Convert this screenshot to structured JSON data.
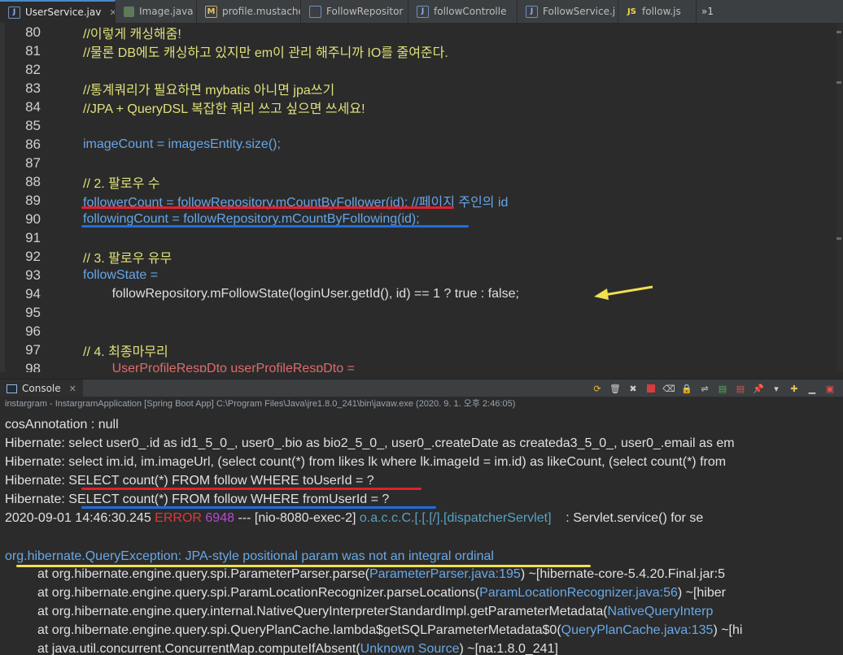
{
  "editor_tabs": [
    {
      "label": "UserService.jav",
      "icon": "java-file-icon",
      "active": true
    },
    {
      "label": "Image.java",
      "icon": "java-file-icon",
      "active": false
    },
    {
      "label": "profile.mustache",
      "icon": "mustache-file-icon",
      "active": false
    },
    {
      "label": "FollowRepositor",
      "icon": "java-file-icon",
      "active": false
    },
    {
      "label": "followControlle",
      "icon": "java-file-icon",
      "active": false
    },
    {
      "label": "FollowService.j",
      "icon": "java-file-icon",
      "active": false
    },
    {
      "label": "follow.js",
      "icon": "js-file-icon",
      "active": false
    }
  ],
  "tabs_overflow": "»1",
  "code": {
    "lines": [
      {
        "n": "80",
        "text": "//이렇게 캐싱해줌!"
      },
      {
        "n": "81",
        "text": "//물론 DB에도 캐싱하고 있지만 em이 관리 해주니까 IO를 줄여준다."
      },
      {
        "n": "82",
        "text": ""
      },
      {
        "n": "83",
        "text": "//통계쿼리가 필요하면 mybatis 아니면 jpa쓰기"
      },
      {
        "n": "84",
        "text": "//JPA + QueryDSL 복잡한 쿼리 쓰고 싶으면 쓰세요!"
      },
      {
        "n": "85",
        "text": ""
      },
      {
        "n": "86",
        "text": "imageCount = imagesEntity.size();"
      },
      {
        "n": "87",
        "text": ""
      },
      {
        "n": "88",
        "text": "// 2. 팔로우 수"
      },
      {
        "n": "89",
        "text": "followerCount = followRepository.mCountByFollower(id); //페이지 주인의 id"
      },
      {
        "n": "90",
        "text": "followingCount = followRepository.mCountByFollowing(id);"
      },
      {
        "n": "91",
        "text": ""
      },
      {
        "n": "92",
        "text": "// 3. 팔로우 유무"
      },
      {
        "n": "93",
        "text": "followState ="
      },
      {
        "n": "94",
        "text": "        followRepository.mFollowState(loginUser.getId(), id) == 1 ? true : false;"
      },
      {
        "n": "95",
        "text": ""
      },
      {
        "n": "96",
        "text": ""
      },
      {
        "n": "97",
        "text": "// 4. 최종마무리"
      },
      {
        "n": "98",
        "text": "        UserProfileRespDto userProfileRespDto ="
      }
    ]
  },
  "console": {
    "tab_label": "Console",
    "launch_info": "instargram - InstargramApplication [Spring Boot App] C:\\Program Files\\Java\\jre1.8.0_241\\bin\\javaw.exe (2020. 9. 1. 오후 2:46:05)",
    "log_lines": [
      "cosAnnotation : null",
      "Hibernate: select user0_.id as id1_5_0_, user0_.bio as bio2_5_0_, user0_.createDate as createda3_5_0_, user0_.email as em",
      "Hibernate: select im.id, im.imageUrl, (select count(*) from likes lk where lk.imageId = im.id) as likeCount, (select count(*) from",
      "Hibernate: SELECT count(*) FROM follow WHERE toUserId = ?",
      "Hibernate: SELECT count(*) FROM follow WHERE fromUserId = ?"
    ],
    "error_line": {
      "timestamp": "2020-09-01 14:46:30.245",
      "level": "ERROR",
      "pid": "6948",
      "sep": "---",
      "thread": "[nio-8080-exec-2]",
      "logger": "o.a.c.c.C.[.[.[/].[dispatcherServlet]",
      "message": ": Servlet.service() for se"
    },
    "exception": {
      "class_name": "org.hibernate.QueryException",
      "message": ": JPA-style positional param was not an integral ordinal"
    },
    "stack_trace": [
      {
        "at": "at org.hibernate.engine.query.spi.ParameterParser.parse(",
        "link": "ParameterParser.java:195",
        "rest": ") ~[hibernate-core-5.4.20.Final.jar:5"
      },
      {
        "at": "at org.hibernate.engine.query.spi.ParamLocationRecognizer.parseLocations(",
        "link": "ParamLocationRecognizer.java:56",
        "rest": ") ~[hiber"
      },
      {
        "at": "at org.hibernate.engine.query.internal.NativeQueryInterpreterStandardImpl.getParameterMetadata(",
        "link": "NativeQueryInterp",
        "rest": ""
      },
      {
        "at": "at org.hibernate.engine.query.spi.QueryPlanCache.lambda$getSQLParameterMetadata$0(",
        "link": "QueryPlanCache.java:135",
        "rest": ") ~[hi"
      },
      {
        "at": "at java.util.concurrent.ConcurrentMap.computeIfAbsent(",
        "link": "Unknown Source",
        "rest": ") ~[na:1.8.0_241]"
      }
    ]
  },
  "colors": {
    "editor_bg": "#2b2b2b",
    "comment": "#dfe07a",
    "field": "#66a6e8",
    "error": "#d93b3b",
    "annotation_red": "#e3202b",
    "annotation_blue": "#1d6fe0",
    "annotation_yellow": "#f0e050"
  }
}
